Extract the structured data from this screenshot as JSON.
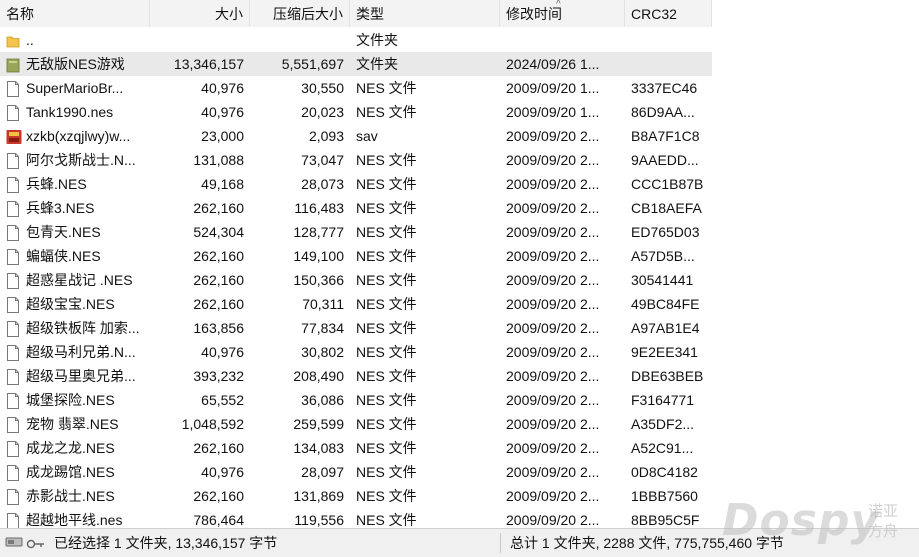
{
  "headers": {
    "name": "名称",
    "size": "大小",
    "packed": "压缩后大小",
    "type": "类型",
    "modified": "修改时间",
    "crc": "CRC32"
  },
  "rows": [
    {
      "icon": "folder-up-icon",
      "name": "..",
      "size": "",
      "packed": "",
      "type": "文件夹",
      "modified": "",
      "crc": ""
    },
    {
      "icon": "folder-icon",
      "name": "无敌版NES游戏",
      "size": "13,346,157",
      "packed": "5,551,697",
      "type": "文件夹",
      "modified": "2024/09/26 1...",
      "crc": "",
      "selected": true
    },
    {
      "icon": "file-icon",
      "name": "SuperMarioBr...",
      "size": "40,976",
      "packed": "30,550",
      "type": "NES 文件",
      "modified": "2009/09/20 1...",
      "crc": "3337EC46"
    },
    {
      "icon": "file-icon",
      "name": "Tank1990.nes",
      "size": "40,976",
      "packed": "20,023",
      "type": "NES 文件",
      "modified": "2009/09/20 1...",
      "crc": "86D9AA..."
    },
    {
      "icon": "sav-icon",
      "name": "xzkb(xzqjlwy)w...",
      "size": "23,000",
      "packed": "2,093",
      "type": "sav",
      "modified": "2009/09/20 2...",
      "crc": "B8A7F1C8"
    },
    {
      "icon": "file-icon",
      "name": "阿尔戈斯战士.N...",
      "size": "131,088",
      "packed": "73,047",
      "type": "NES 文件",
      "modified": "2009/09/20 2...",
      "crc": "9AAEDD..."
    },
    {
      "icon": "file-icon",
      "name": "兵蜂.NES",
      "size": "49,168",
      "packed": "28,073",
      "type": "NES 文件",
      "modified": "2009/09/20 2...",
      "crc": "CCC1B87B"
    },
    {
      "icon": "file-icon",
      "name": "兵蜂3.NES",
      "size": "262,160",
      "packed": "116,483",
      "type": "NES 文件",
      "modified": "2009/09/20 2...",
      "crc": "CB18AEFA"
    },
    {
      "icon": "file-icon",
      "name": "包青天.NES",
      "size": "524,304",
      "packed": "128,777",
      "type": "NES 文件",
      "modified": "2009/09/20 2...",
      "crc": "ED765D03"
    },
    {
      "icon": "file-icon",
      "name": "蝙蝠侠.NES",
      "size": "262,160",
      "packed": "149,100",
      "type": "NES 文件",
      "modified": "2009/09/20 2...",
      "crc": "A57D5B..."
    },
    {
      "icon": "file-icon",
      "name": "超惑星战记 .NES",
      "size": "262,160",
      "packed": "150,366",
      "type": "NES 文件",
      "modified": "2009/09/20 2...",
      "crc": "30541441"
    },
    {
      "icon": "file-icon",
      "name": "超级宝宝.NES",
      "size": "262,160",
      "packed": "70,311",
      "type": "NES 文件",
      "modified": "2009/09/20 2...",
      "crc": "49BC84FE"
    },
    {
      "icon": "file-icon",
      "name": "超级铁板阵 加索...",
      "size": "163,856",
      "packed": "77,834",
      "type": "NES 文件",
      "modified": "2009/09/20 2...",
      "crc": "A97AB1E4"
    },
    {
      "icon": "file-icon",
      "name": "超级马利兄弟.N...",
      "size": "40,976",
      "packed": "30,802",
      "type": "NES 文件",
      "modified": "2009/09/20 2...",
      "crc": "9E2EE341"
    },
    {
      "icon": "file-icon",
      "name": "超级马里奥兄弟...",
      "size": "393,232",
      "packed": "208,490",
      "type": "NES 文件",
      "modified": "2009/09/20 2...",
      "crc": "DBE63BEB"
    },
    {
      "icon": "file-icon",
      "name": "城堡探险.NES",
      "size": "65,552",
      "packed": "36,086",
      "type": "NES 文件",
      "modified": "2009/09/20 2...",
      "crc": "F3164771"
    },
    {
      "icon": "file-icon",
      "name": "宠物 翡翠.NES",
      "size": "1,048,592",
      "packed": "259,599",
      "type": "NES 文件",
      "modified": "2009/09/20 2...",
      "crc": "A35DF2..."
    },
    {
      "icon": "file-icon",
      "name": "成龙之龙.NES",
      "size": "262,160",
      "packed": "134,083",
      "type": "NES 文件",
      "modified": "2009/09/20 2...",
      "crc": "A52C91..."
    },
    {
      "icon": "file-icon",
      "name": "成龙踢馆.NES",
      "size": "40,976",
      "packed": "28,097",
      "type": "NES 文件",
      "modified": "2009/09/20 2...",
      "crc": "0D8C4182"
    },
    {
      "icon": "file-icon",
      "name": "赤影战士.NES",
      "size": "262,160",
      "packed": "131,869",
      "type": "NES 文件",
      "modified": "2009/09/20 2...",
      "crc": "1BBB7560"
    },
    {
      "icon": "file-icon",
      "name": "超越地平线.nes",
      "size": "786,464",
      "packed": "119,556",
      "type": "NES 文件",
      "modified": "2009/09/20 2...",
      "crc": "8BB95C5F"
    }
  ],
  "status": {
    "left": "已经选择 1 文件夹, 13,346,157 字节",
    "right": "总计 1 文件夹, 2288 文件, 775,755,460 字节"
  },
  "watermark": {
    "main": "Dospy",
    "sub1": "诺亚",
    "sub2": "方舟"
  }
}
